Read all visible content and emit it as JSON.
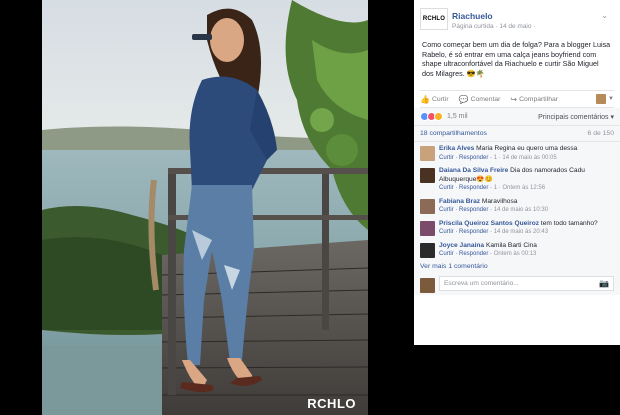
{
  "photo": {
    "watermark": "RCHLO"
  },
  "post": {
    "logo_text": "RCHLO",
    "page_name": "Riachuelo",
    "meta": "Página curtida · 14 de maio ·",
    "text": "Como começar bem um dia de folga? Para a blogger Luisa Rabelo, é só entrar em uma calça jeans boyfriend com shape ultraconfortável da Riachuelo e curtir São Miguel dos Milagres. 😎🌴",
    "actions": {
      "like": "Curtir",
      "comment": "Comentar",
      "share": "Compartilhar"
    },
    "reactions_count": "1,5 mil",
    "sort_label": "Principais comentários ▾",
    "shares_label": "18 compartilhamentos",
    "pagination": "6 de 150",
    "comments": [
      {
        "name": "Erika Alves",
        "text": "Maria Regina eu quero uma dessa",
        "meta_action": "Curtir · Responder ·",
        "meta_extra": "1 · 14 de maio às 00:05",
        "avatar_color": "#c9a27b"
      },
      {
        "name": "Daiana Da Silva Freire",
        "text": "Dia dos namorados Cadu Albuquerque😍😊",
        "meta_action": "Curtir · Responder ·",
        "meta_extra": "1 · Ontem às 12:56",
        "avatar_color": "#4a3222"
      },
      {
        "name": "Fabiana Braz",
        "text": "Maravilhosa",
        "meta_action": "Curtir · Responder ·",
        "meta_extra": "14 de maio às 10:30",
        "avatar_color": "#8c6a58"
      },
      {
        "name": "Priscila Queiroz Santos Queiroz",
        "text": "tem todo tamanho?",
        "meta_action": "Curtir · Responder ·",
        "meta_extra": "14 de maio às 20:43",
        "avatar_color": "#7a4b6b"
      },
      {
        "name": "Joyce Janaina",
        "text": "Kamila Barti Cina",
        "meta_action": "Curtir · Responder ·",
        "meta_extra": "Ontem às 00:13",
        "avatar_color": "#2b2b2b"
      }
    ],
    "more_label": "Ver mais 1 comentário",
    "write_placeholder": "Escreva um comentário...",
    "icons": {
      "chevron": "chevron-down-icon",
      "like": "thumbs-up-icon",
      "comment": "speech-bubble-icon",
      "share": "share-arrow-icon",
      "camera": "camera-icon"
    },
    "reaction_colors": [
      "#5890ff",
      "#f25268",
      "#f7b125"
    ]
  }
}
